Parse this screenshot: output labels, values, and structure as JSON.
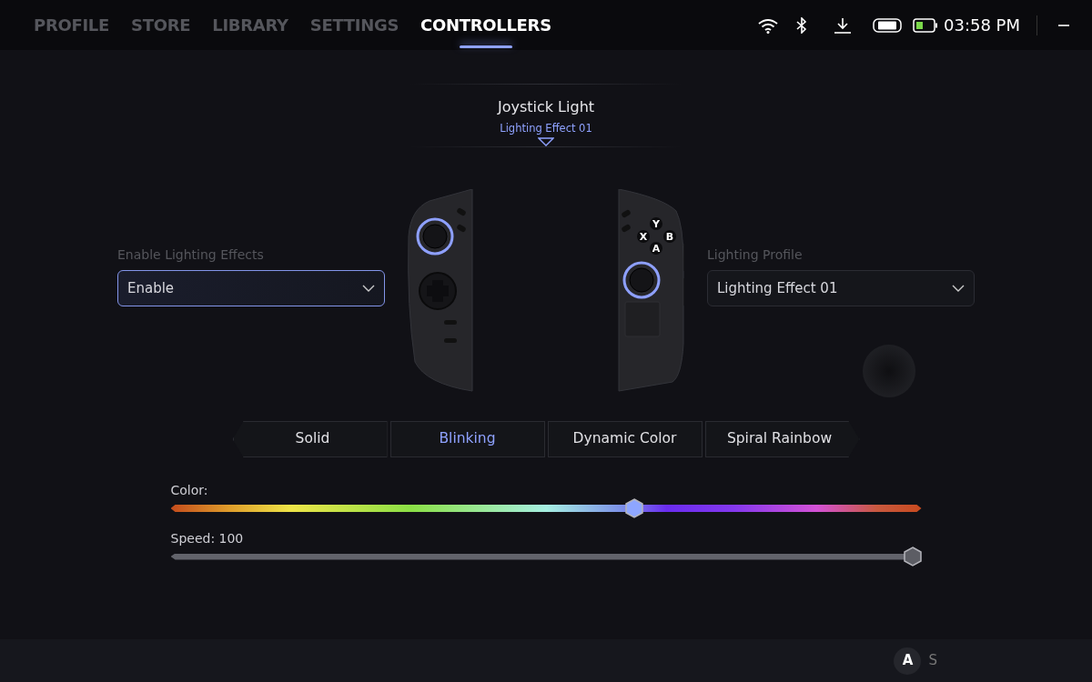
{
  "nav": {
    "tabs": [
      {
        "label": "PROFILE",
        "selected": false
      },
      {
        "label": "STORE",
        "selected": false
      },
      {
        "label": "LIBRARY",
        "selected": false
      },
      {
        "label": "SETTINGS",
        "selected": false
      },
      {
        "label": "CONTROLLERS",
        "selected": true
      }
    ]
  },
  "status_bar": {
    "time": "03:58 PM"
  },
  "header": {
    "title": "Joystick Light",
    "subtitle": "Lighting Effect 01"
  },
  "lighting_toggle": {
    "label": "Enable Lighting Effects",
    "value": "Enable",
    "focused": true
  },
  "lighting_profile": {
    "label": "Lighting Profile",
    "value": "Lighting Effect 01",
    "focused": false
  },
  "face_buttons": [
    "Y",
    "X",
    "B",
    "A"
  ],
  "effects": [
    {
      "label": "Solid",
      "selected": false
    },
    {
      "label": "Blinking",
      "selected": true
    },
    {
      "label": "Dynamic Color",
      "selected": false
    },
    {
      "label": "Spiral Rainbow",
      "selected": false
    }
  ],
  "sliders": [
    {
      "kind": "color",
      "label": "Color:",
      "level": 0.62
    },
    {
      "kind": "speed",
      "label": "Speed: 100",
      "level": 1
    }
  ],
  "footer": {
    "key": "A",
    "label": "S"
  }
}
